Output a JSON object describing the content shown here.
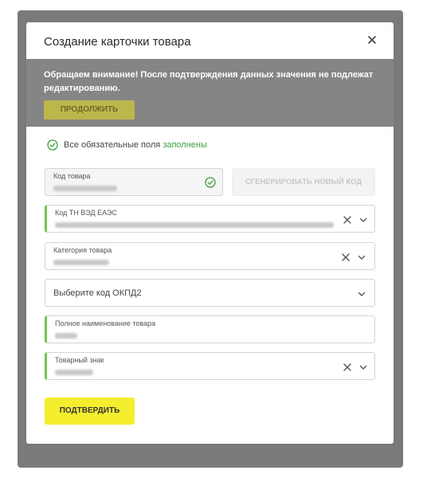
{
  "modal": {
    "title": "Создание карточки товара"
  },
  "notice": {
    "text": "Обращаем внимание! После подтверждения данных значения не подлежат редактированию.",
    "continue_label": "ПРОДОЛЖИТЬ"
  },
  "status": {
    "prefix": "Все обязательные поля",
    "link": "заполнены"
  },
  "fields": {
    "product_code": {
      "label": "Код товара"
    },
    "generate_label": "СГЕНЕРИРОВАТЬ НОВЫЙ КОД",
    "tnved": {
      "label": "Код ТН ВЭД ЕАЭС"
    },
    "category": {
      "label": "Категория товара"
    },
    "okpd2": {
      "placeholder": "Выберите код ОКПД2"
    },
    "full_name": {
      "label": "Полное наименование товара"
    },
    "trademark": {
      "label": "Товарный знак"
    }
  },
  "confirm_label": "ПОДТВЕРДИТЬ",
  "colors": {
    "accent_green": "#6cc94c",
    "confirm_yellow": "#f5ee2e",
    "continue_olive": "#bdb64a",
    "notice_gray": "#858585"
  }
}
